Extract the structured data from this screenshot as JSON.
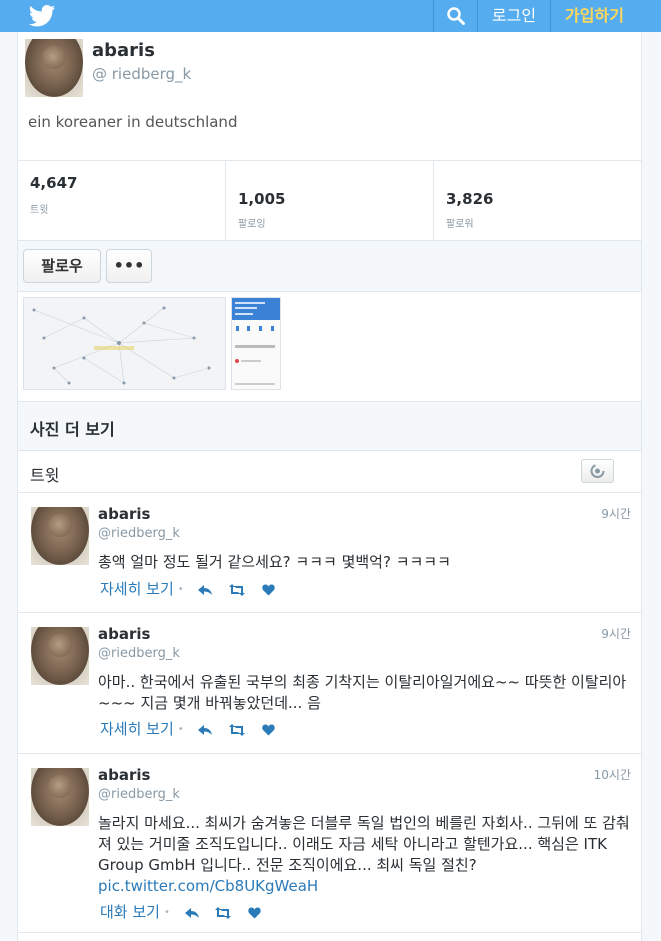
{
  "topbar": {
    "logo_icon": "twitter-bird-icon",
    "search_icon": "search-icon",
    "login_label": "로그인",
    "signup_label": "가입하기",
    "brand_color": "#55acee",
    "signup_color": "#ffd85a"
  },
  "profile": {
    "name": "abaris",
    "handle": "@ riedberg_k",
    "bio": "ein koreaner in deutschland"
  },
  "stats": [
    {
      "value": "4,647",
      "label": "트윗"
    },
    {
      "value": "1,005",
      "label": "팔로잉"
    },
    {
      "value": "3,826",
      "label": "팔로워"
    }
  ],
  "actions": {
    "follow_label": "팔로우",
    "more_label": "•••"
  },
  "media": {
    "more_photos_label": "사진 더 보기"
  },
  "tweets_section": {
    "title": "트윗",
    "refresh_icon": "refresh-icon"
  },
  "tweets": [
    {
      "name": "abaris",
      "handle": "@riedberg_k",
      "time": "9시간",
      "text": "총액 얼마 정도 될거 같으세요? ㅋㅋㅋ 몇백억? ㅋㅋㅋㅋ",
      "link": "",
      "action_label": "자세히 보기"
    },
    {
      "name": "abaris",
      "handle": "@riedberg_k",
      "time": "9시간",
      "text": "아마.. 한국에서 유출된 국부의 최종 기착지는 이탈리아일거에요~~ 따뜻한 이탈리아~~~ 지금 몇개 바꿔놓았던데... 음",
      "link": "",
      "action_label": "자세히 보기"
    },
    {
      "name": "abaris",
      "handle": "@riedberg_k",
      "time": "10시간",
      "text": "놀라지 마세요... 최씨가 숨겨놓은 더블루 독일 법인의 베를린 자회사.. 그뒤에 또 감춰져 있는 거미줄 조직도입니다.. 이래도 자금 세탁 아니라고 할텐가요... 핵심은 ITK Group GmbH 입니다.. 전문 조직이에요... 최씨 독일 절친?",
      "link": "pic.twitter.com/Cb8UKgWeaH",
      "action_label": "대화 보기"
    }
  ],
  "action_icons": [
    "reply-icon",
    "retweet-icon",
    "like-icon"
  ],
  "link_color": "#2b7bb9"
}
